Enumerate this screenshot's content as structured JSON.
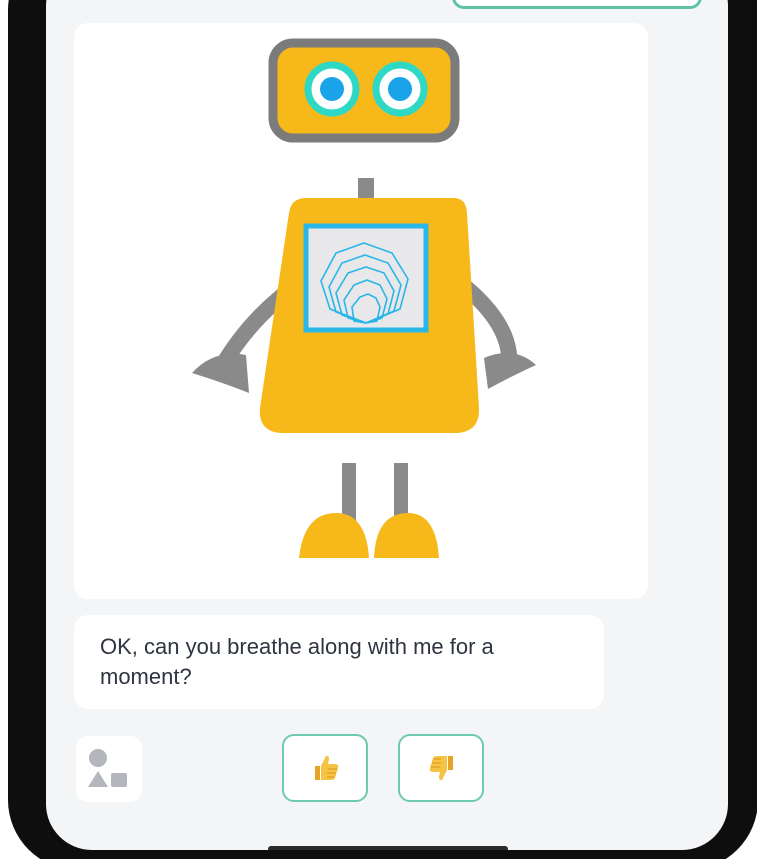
{
  "chat": {
    "bot_image": {
      "subject": "robot-mascot",
      "colors": {
        "body": "#f7b81a",
        "limbs": "#8a8a8a",
        "eye_ring": "#2fd8c4",
        "eye_pupil": "#1aa3e8",
        "chest_lines": "#29b6e8"
      }
    },
    "message": {
      "text": "OK, can you breathe along with me for a moment?"
    }
  },
  "input_bar": {
    "shapes_button": {
      "icon": "shapes-icon"
    },
    "reactions": [
      {
        "icon": "thumbs-up-icon",
        "glyph": "👍"
      },
      {
        "icon": "thumbs-down-icon",
        "glyph": "👎"
      }
    ],
    "accent_color": "#6fc9ae"
  }
}
